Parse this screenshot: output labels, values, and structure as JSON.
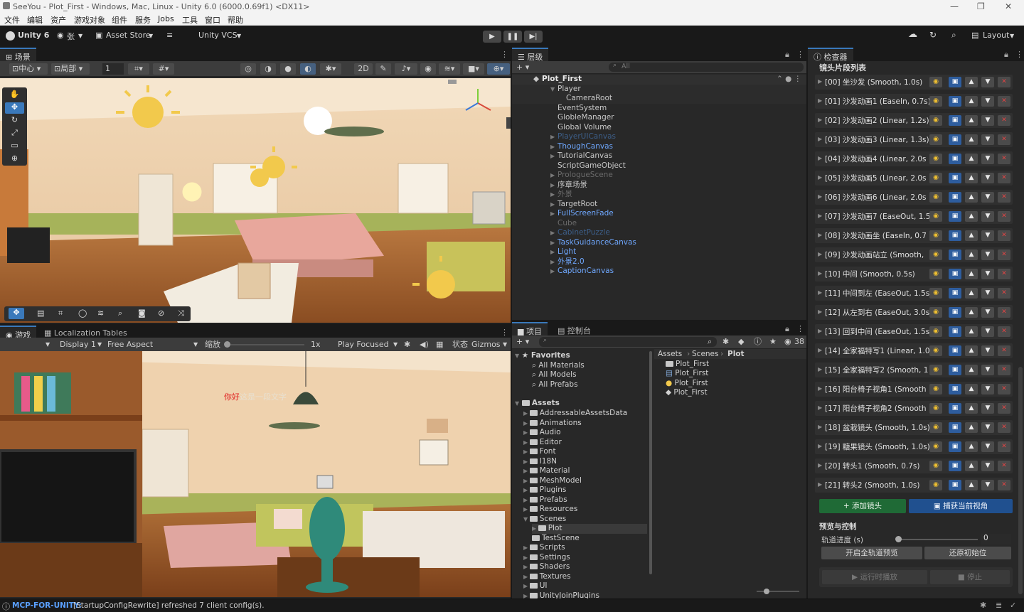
{
  "window": {
    "title": "SeeYou - Plot_First - Windows, Mac, Linux - Unity 6.0 (6000.0.69f1) <DX11>"
  },
  "menu": [
    "文件",
    "编辑",
    "资产",
    "游戏对象",
    "组件",
    "服务",
    "Jobs",
    "工具",
    "窗口",
    "帮助"
  ],
  "toolbar": {
    "unity_label": "Unity 6",
    "account": "张",
    "asset_store": "Asset Store",
    "vcs": "Unity VCS",
    "layout": "Layout"
  },
  "scene": {
    "tab": "场景",
    "pivot_center": "中心",
    "pivot_local": "局部",
    "grid_value": "1"
  },
  "game": {
    "tab": "游戏",
    "tab2": "Localization Tables",
    "display": "Display 1",
    "aspect": "Free Aspect",
    "scale_label": "缩放",
    "scale_value": "1x",
    "play_focused": "Play Focused",
    "stats": "状态",
    "gizmos": "Gizmos",
    "subtitle_red": "你好",
    "subtitle_rest": "这是一段文字"
  },
  "hierarchy": {
    "tab": "层级",
    "search_placeholder": "All",
    "scene": "Plot_First",
    "items": [
      {
        "label": "Player",
        "color": "#c8c8c8",
        "indent": 1,
        "expanded": true,
        "sel": true
      },
      {
        "label": "CameraRoot",
        "color": "#c8c8c8",
        "indent": 2,
        "sel": true
      },
      {
        "label": "EventSystem",
        "color": "#c8c8c8",
        "indent": 1
      },
      {
        "label": "GlobleManager",
        "color": "#c8c8c8",
        "indent": 1
      },
      {
        "label": "Global Volume",
        "color": "#c8c8c8",
        "indent": 1
      },
      {
        "label": "PlayerUICanvas",
        "color": "#3d5f8a",
        "indent": 1,
        "arrow": true
      },
      {
        "label": "ThoughCanvas",
        "color": "#6fa8ff",
        "indent": 1,
        "arrow": true
      },
      {
        "label": "TutorialCanvas",
        "color": "#c8c8c8",
        "indent": 1,
        "arrow": true
      },
      {
        "label": "ScriptGameObject",
        "color": "#c8c8c8",
        "indent": 1
      },
      {
        "label": "PrologueScene",
        "color": "#6a6a6a",
        "indent": 1,
        "arrow": true
      },
      {
        "label": "序章场景",
        "color": "#c8c8c8",
        "indent": 1,
        "arrow": true
      },
      {
        "label": "外景",
        "color": "#6a6a6a",
        "indent": 1,
        "arrow": true
      },
      {
        "label": "TargetRoot",
        "color": "#c8c8c8",
        "indent": 1,
        "arrow": true
      },
      {
        "label": "FullScreenFade",
        "color": "#6fa8ff",
        "indent": 1,
        "arrow": true
      },
      {
        "label": "Cube",
        "color": "#6a6a6a",
        "indent": 1
      },
      {
        "label": "CabinetPuzzle",
        "color": "#3d5f8a",
        "indent": 1,
        "arrow": true
      },
      {
        "label": "TaskGuidanceCanvas",
        "color": "#6fa8ff",
        "indent": 1,
        "arrow": true
      },
      {
        "label": "Light",
        "color": "#6fa8ff",
        "indent": 1,
        "arrow": true
      },
      {
        "label": "外景2.0",
        "color": "#6fa8ff",
        "indent": 1,
        "arrow": true
      },
      {
        "label": "CaptionCanvas",
        "color": "#6fa8ff",
        "indent": 1,
        "arrow": true
      }
    ]
  },
  "project": {
    "tab": "项目",
    "tab2": "控制台",
    "count": "38",
    "favorites_label": "Favorites",
    "favorites": [
      "All Materials",
      "All Models",
      "All Prefabs"
    ],
    "assets_label": "Assets",
    "folders": [
      "AddressableAssetsData",
      "Animations",
      "Audio",
      "Editor",
      "Font",
      "I18N",
      "Material",
      "MeshModel",
      "Plugins",
      "Prefabs",
      "Resources",
      "Scenes",
      "Plot",
      "TestScene",
      "Scripts",
      "Settings",
      "Shaders",
      "Textures",
      "UI",
      "UnityJoinPlugins"
    ],
    "breadcrumb": [
      "Assets",
      "Scenes",
      "Plot"
    ],
    "files": [
      "Plot_First",
      "Plot_First",
      "Plot_First",
      "Plot_First"
    ]
  },
  "inspector": {
    "tab": "检查器",
    "section_title": "镜头片段列表",
    "items": [
      "[00]  坐沙发  (Smooth, 1.0s)",
      "[01]  沙发动画1  (EaseIn, 0.7s)",
      "[02]  沙发动画2  (Linear, 1.2s)",
      "[03]  沙发动画3  (Linear, 1.3s)",
      "[04]  沙发动画4  (Linear, 2.0s",
      "[05]  沙发动画5  (Linear, 2.0s",
      "[06]  沙发动画6  (Linear, 2.0s",
      "[07]  沙发动画7  (EaseOut, 1.5",
      "[08]  沙发动画坐  (EaseIn, 0.7",
      "[09]  沙发动画站立  (Smooth,",
      "[10]  中间  (Smooth, 0.5s)",
      "[11]  中间到左  (EaseOut, 1.5s",
      "[12]  从左到右  (EaseOut, 3.0s",
      "[13]  回到中间  (EaseOut, 1.5s",
      "[14]  全家福特写1  (Linear, 1.0",
      "[15]  全家福特写2  (Smooth, 1",
      "[16]  阳台椅子视角1  (Smooth",
      "[17]  阳台椅子视角2  (Smooth",
      "[18]  盆栽镜头  (Smooth, 1.0s)",
      "[19]  糖果镜头  (Smooth, 1.0s)",
      "[20]  转头1  (Smooth, 0.7s)",
      "[21]  转头2  (Smooth, 1.0s)"
    ],
    "add_button": "+ 添加镜头",
    "capture_button": "捕获当前视角",
    "preview_title": "预览与控制",
    "track_label": "轨道进度 (s)",
    "track_value": "0",
    "start_preview": "开启全轨道预览",
    "restore": "还原初始位",
    "runtime_play": "▶ 运行时播放",
    "stop": "■ 停止"
  },
  "status": {
    "source": "MCP-FOR-UNITY:",
    "message": " [StartupConfigRewrite] refreshed 7 client config(s)."
  },
  "colors": {
    "accent": "#3a79bb",
    "panel": "#282828",
    "green_button": "#1f6a36",
    "blue_button": "#20508f"
  }
}
